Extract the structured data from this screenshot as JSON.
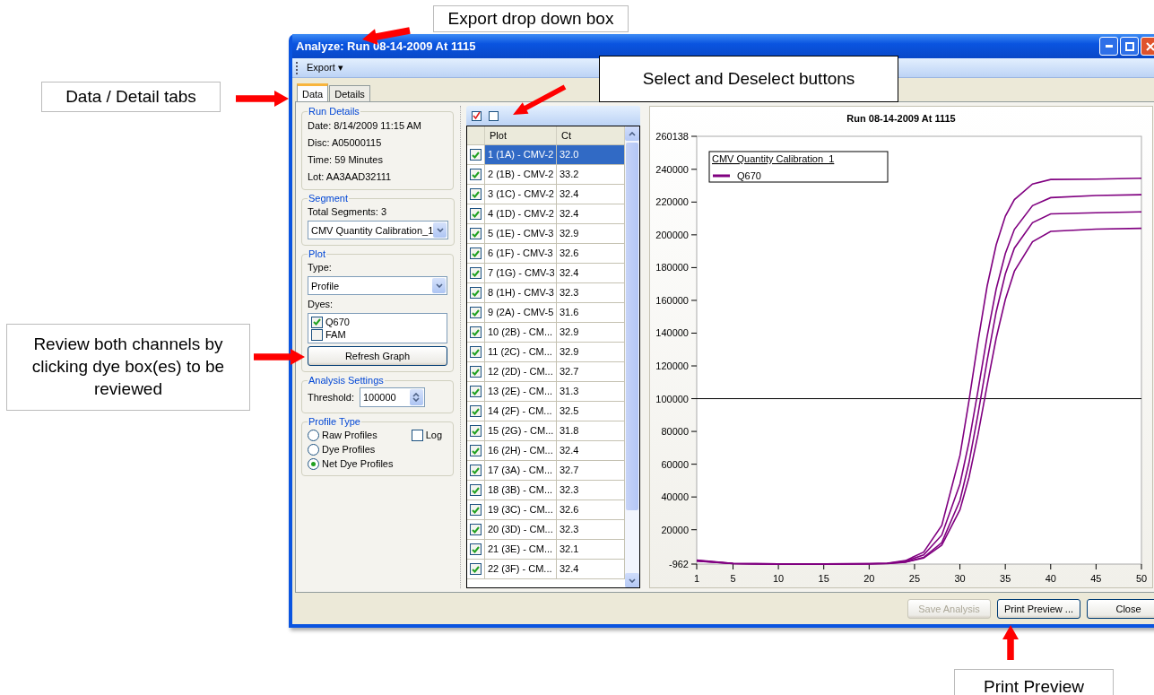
{
  "callouts": [
    {
      "text": "Export drop down box"
    },
    {
      "text": "Data / Detail tabs"
    },
    {
      "text": "Select and Deselect buttons"
    },
    {
      "text": "Review both channels by clicking dye box(es) to be reviewed"
    },
    {
      "text": "Print Preview"
    }
  ],
  "window": {
    "title": "Analyze: Run 08-14-2009 At 1115"
  },
  "toolbar": {
    "menu": "Export",
    "menu_arrow": "▾"
  },
  "tabs": [
    {
      "label": "Data",
      "selected": true
    },
    {
      "label": "Details",
      "selected": false
    }
  ],
  "run_details": {
    "title": "Run Details",
    "lines": [
      "Date: 8/14/2009 11:15 AM",
      "Disc: A05000115",
      "Time: 59 Minutes",
      "Lot: AA3AAD32111"
    ]
  },
  "segment": {
    "title": "Segment",
    "total": "Total Segments: 3",
    "value": "CMV Quantity Calibration_1"
  },
  "plot": {
    "title": "Plot",
    "type_label": "Type:",
    "type_value": "Profile",
    "dyes_label": "Dyes:",
    "dyes": [
      {
        "label": "Q670",
        "checked": true
      },
      {
        "label": "FAM",
        "checked": false
      }
    ],
    "button": "Refresh Graph"
  },
  "analysis_settings": {
    "title": "Analysis Settings",
    "threshold_label": "Threshold:",
    "threshold_value": "100000"
  },
  "profile_type": {
    "title": "Profile Type",
    "options": [
      {
        "label": "Raw Profiles",
        "selected": false
      },
      {
        "label": "Dye Profiles",
        "selected": false
      },
      {
        "label": "Net Dye Profiles",
        "selected": true
      }
    ],
    "log": {
      "label": "Log",
      "checked": false
    }
  },
  "grid": {
    "columns": [
      "Plot",
      "Ct"
    ],
    "rows": [
      {
        "plot": "1 (1A) - CMV-2",
        "ct": "32.0",
        "checked": true,
        "selected": true
      },
      {
        "plot": "2 (1B) - CMV-2",
        "ct": "33.2",
        "checked": true,
        "selected": false
      },
      {
        "plot": "3 (1C) - CMV-2",
        "ct": "32.4",
        "checked": true,
        "selected": false
      },
      {
        "plot": "4 (1D) - CMV-2",
        "ct": "32.4",
        "checked": true,
        "selected": false
      },
      {
        "plot": "5 (1E) - CMV-3",
        "ct": "32.9",
        "checked": true,
        "selected": false
      },
      {
        "plot": "6 (1F) - CMV-3",
        "ct": "32.6",
        "checked": true,
        "selected": false
      },
      {
        "plot": "7 (1G) - CMV-3",
        "ct": "32.4",
        "checked": true,
        "selected": false
      },
      {
        "plot": "8 (1H) - CMV-3",
        "ct": "32.3",
        "checked": true,
        "selected": false
      },
      {
        "plot": "9 (2A) - CMV-5",
        "ct": "31.6",
        "checked": true,
        "selected": false
      },
      {
        "plot": "10 (2B) - CM...",
        "ct": "32.9",
        "checked": true,
        "selected": false
      },
      {
        "plot": "11 (2C) - CM...",
        "ct": "32.9",
        "checked": true,
        "selected": false
      },
      {
        "plot": "12 (2D) - CM...",
        "ct": "32.7",
        "checked": true,
        "selected": false
      },
      {
        "plot": "13 (2E) - CM...",
        "ct": "31.3",
        "checked": true,
        "selected": false
      },
      {
        "plot": "14 (2F) - CM...",
        "ct": "32.5",
        "checked": true,
        "selected": false
      },
      {
        "plot": "15 (2G) - CM...",
        "ct": "31.8",
        "checked": true,
        "selected": false
      },
      {
        "plot": "16 (2H) - CM...",
        "ct": "32.4",
        "checked": true,
        "selected": false
      },
      {
        "plot": "17 (3A) - CM...",
        "ct": "32.7",
        "checked": true,
        "selected": false
      },
      {
        "plot": "18 (3B) - CM...",
        "ct": "32.3",
        "checked": true,
        "selected": false
      },
      {
        "plot": "19 (3C) - CM...",
        "ct": "32.6",
        "checked": true,
        "selected": false
      },
      {
        "plot": "20 (3D) - CM...",
        "ct": "32.3",
        "checked": true,
        "selected": false
      },
      {
        "plot": "21 (3E) - CM...",
        "ct": "32.1",
        "checked": true,
        "selected": false
      },
      {
        "plot": "22 (3F) - CM...",
        "ct": "32.4",
        "checked": true,
        "selected": false
      }
    ]
  },
  "chart": {
    "legend_title": "CMV Quantity Calibration_1",
    "chart_data": {
      "type": "line",
      "title": "Run 08-14-2009 At 1115",
      "x": [
        1,
        5,
        10,
        15,
        20,
        22,
        24,
        26,
        28,
        30,
        31,
        32,
        33,
        34,
        35,
        36,
        38,
        40,
        45,
        50
      ],
      "series": [
        {
          "name": "Q670",
          "color": "#800080",
          "values": [
            1500,
            -500,
            -900,
            -900,
            -700,
            -400,
            1200,
            6400,
            22600,
            65300,
            98800,
            135100,
            168700,
            193900,
            211400,
            221500,
            231000,
            233800,
            234000,
            234500
          ]
        },
        {
          "color": "#800080",
          "values": [
            1200,
            -600,
            -900,
            -900,
            -700,
            -500,
            800,
            4700,
            16700,
            47900,
            73600,
            105200,
            138000,
            166900,
            188600,
            203300,
            217800,
            222700,
            224000,
            224500
          ]
        },
        {
          "color": "#800080",
          "values": [
            1000,
            -700,
            -900,
            -900,
            -800,
            -600,
            300,
            3100,
            12200,
            37900,
            61000,
            90800,
            123200,
            153000,
            176100,
            191900,
            207400,
            212800,
            213500,
            214000
          ]
        },
        {
          "color": "#800080",
          "values": [
            900,
            -700,
            -900,
            -900,
            -800,
            -700,
            200,
            2700,
            10600,
            32200,
            52000,
            78300,
            108200,
            137000,
            160500,
            177800,
            195800,
            202100,
            203500,
            204000
          ]
        }
      ],
      "xlim": [
        1,
        50
      ],
      "ylim": [
        -962,
        260138
      ],
      "xticks": [
        1,
        5,
        10,
        15,
        20,
        25,
        30,
        35,
        40,
        45,
        50
      ],
      "yticks": [
        -962,
        20000,
        40000,
        60000,
        80000,
        100000,
        120000,
        140000,
        160000,
        180000,
        200000,
        220000,
        240000,
        260138
      ]
    }
  },
  "buttons": [
    {
      "label": "Save Analysis",
      "disabled": true
    },
    {
      "label": "Print Preview ...",
      "disabled": false
    },
    {
      "label": "Close",
      "disabled": false
    }
  ]
}
